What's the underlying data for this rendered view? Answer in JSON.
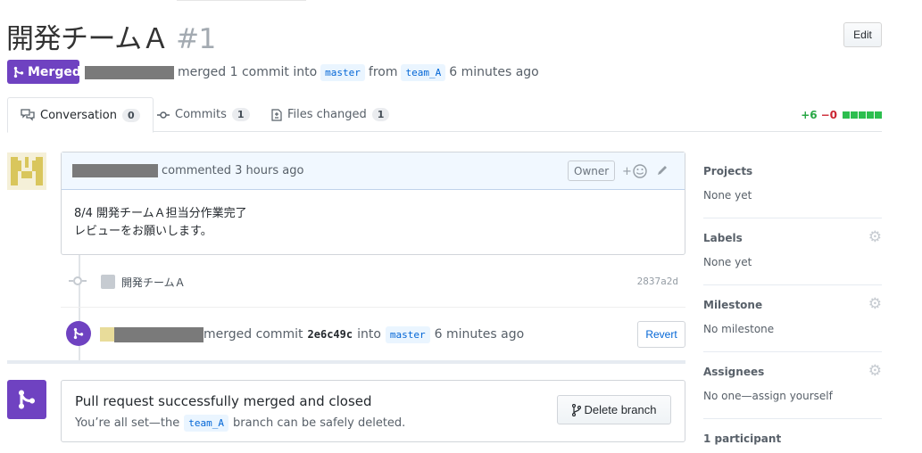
{
  "pr": {
    "title": "開発チームＡ",
    "number": "#1",
    "edit_label": "Edit",
    "state_badge": "Merged",
    "merged_text": "merged 1 commit into",
    "base_branch": "master",
    "from_text": "from",
    "head_branch": "team_A",
    "time_ago": "6 minutes ago"
  },
  "tabs": [
    {
      "label": "Conversation",
      "count": "0"
    },
    {
      "label": "Commits",
      "count": "1"
    },
    {
      "label": "Files changed",
      "count": "1"
    }
  ],
  "diffstat": {
    "additions": "+6",
    "deletions": "−0"
  },
  "comment": {
    "header_text": "commented 3 hours ago",
    "owner_label": "Owner",
    "reaction_plus": "+",
    "body_line1": "8/4 開発チームＡ担当分作業完了",
    "body_line2": "レビューをお願いします。"
  },
  "commit": {
    "message": "開発チームＡ",
    "sha": "2837a2d"
  },
  "merge_event": {
    "text": "merged commit",
    "sha": "2e6c49c",
    "into": "into",
    "branch": "master",
    "time": "6 minutes ago",
    "revert_label": "Revert"
  },
  "merge_box": {
    "title": "Pull request successfully merged and closed",
    "desc_before": "You’re all set—the",
    "branch": "team_A",
    "desc_after": "branch can be safely deleted.",
    "delete_label": "Delete branch"
  },
  "sidebar": [
    {
      "title": "Projects",
      "value": "None yet",
      "gear": false
    },
    {
      "title": "Labels",
      "value": "None yet",
      "gear": true
    },
    {
      "title": "Milestone",
      "value": "No milestone",
      "gear": true
    },
    {
      "title": "Assignees",
      "value": "No one—assign yourself",
      "gear": true
    }
  ],
  "participants": "1 participant",
  "colors": {
    "merged": "#6f42c1",
    "link": "#0366d6",
    "additions": "#28a745",
    "deletions": "#cb2431"
  }
}
